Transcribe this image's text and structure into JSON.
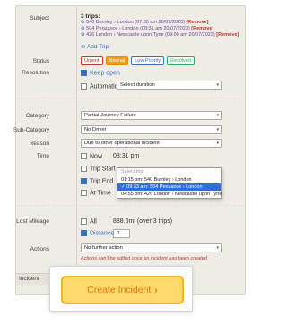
{
  "subject": {
    "label": "Subject",
    "count_label": "3 trips:",
    "trips": [
      {
        "text": "540 Burnley › London (07:05 am 20/07/2023)",
        "remove": "[Remove]"
      },
      {
        "text": "504 Penzance › London (08:31 am 20/07/2023)",
        "remove": "[Remove]"
      },
      {
        "text": "426 London › Newcastle upon Tyne (09:00 am 20/07/2023)",
        "remove": "[Remove]"
      }
    ],
    "add_trip": "Add Trip"
  },
  "status": {
    "label": "Status",
    "options": [
      "Urgent",
      "Normal",
      "Low Priority",
      "Resolved"
    ],
    "selected": "Normal"
  },
  "resolution": {
    "label": "Resolution",
    "keep_open": "Keep open",
    "automatic": "Automatic",
    "duration_placeholder": "Select duration"
  },
  "category": {
    "label": "Category",
    "value": "Partial Journey Failure"
  },
  "subcategory": {
    "label": "Sub-Category",
    "value": "No Driver"
  },
  "reason": {
    "label": "Reason",
    "value": "Due to other operational incident"
  },
  "time": {
    "label": "Time",
    "now": "Now",
    "now_value": "03:31 pm",
    "trip_start": "Trip Start",
    "trip_end": "Trip End",
    "at_time": "At Time",
    "dropdown": {
      "header": "Select trip",
      "options": [
        "01:15 pm: 540 Burnley › London",
        "09:33 am: 504 Penzance › London",
        "04:55 pm: 426 London › Newcastle upon Tyne"
      ],
      "selected_index": 1
    }
  },
  "lost_mileage": {
    "label": "Lost Mileage",
    "all": "All",
    "all_value": "888.6mi (over 3 trips)",
    "distance": "Distance",
    "distance_value": "0"
  },
  "actions": {
    "label": "Actions",
    "value": "No further action",
    "warning": "Actions can't be edited once an incident has been created"
  },
  "incident_tab": "Incident",
  "cta": {
    "label": "Create Incident",
    "arrow": "›"
  }
}
